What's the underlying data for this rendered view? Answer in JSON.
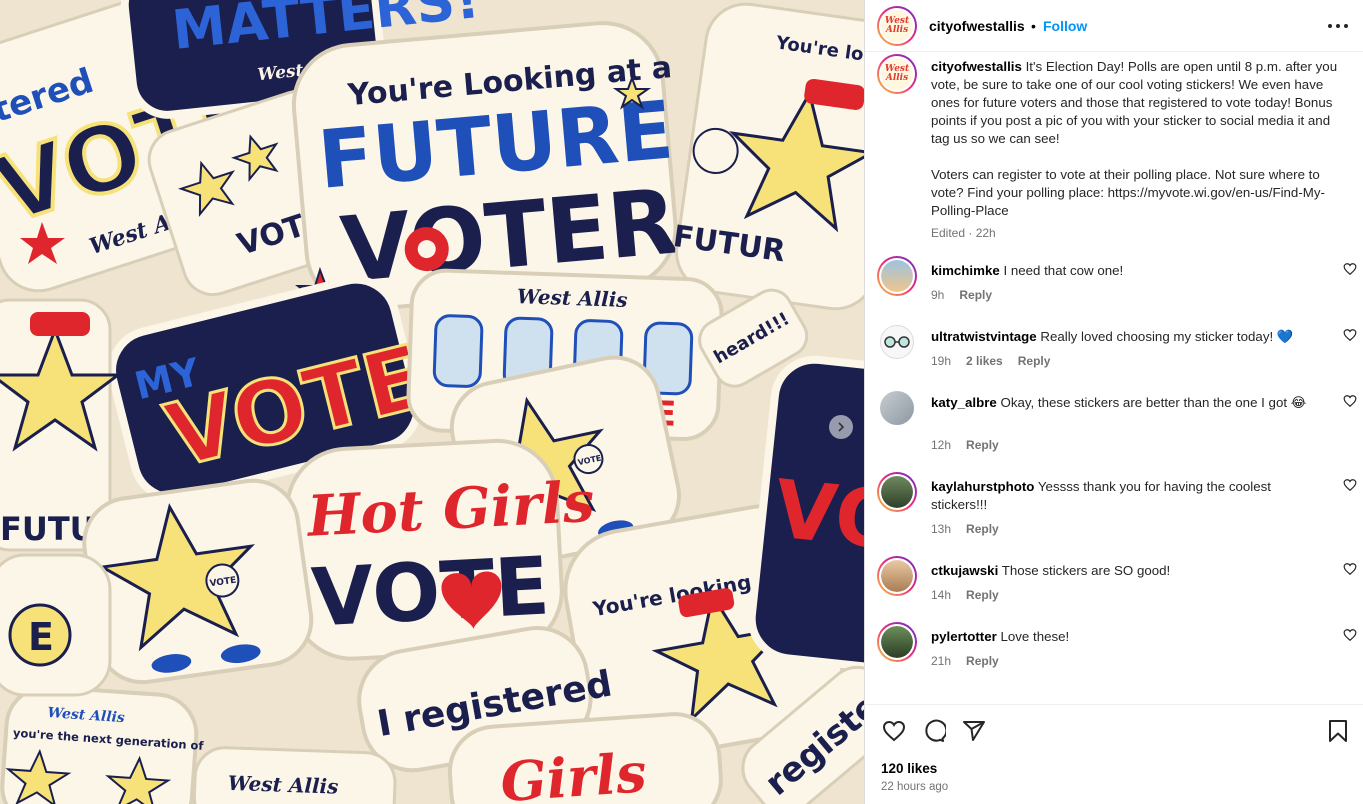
{
  "photo": {
    "alt": "Pile of West Allis voting stickers",
    "stickers": {
      "matters": "MATTERS!",
      "west_allis": "West Allis",
      "looking_at": "You're Looking at a",
      "future": "FUTURE",
      "voter": "VOTER!",
      "voters": "VOTERS!",
      "vote": "VOTE",
      "my": "MY",
      "hot_girls": "Hot Girls",
      "registered": "I registered",
      "registered2": "registe",
      "youre_looking": "You're looking at a",
      "next_gen": "you're the next generation of",
      "heard": "heard!!!",
      "istered": "stered",
      "vote_badge": "VOTE",
      "future2": "FUTUR",
      "vote_big": "VOTE",
      "love_letters": "E",
      "girls": "Girls"
    }
  },
  "header": {
    "username": "cityofwestallis",
    "avatar_text": "West Allis",
    "separator": "•",
    "follow_label": "Follow",
    "more_icon": "more-horizontal-icon"
  },
  "caption": {
    "username": "cityofwestallis",
    "text": "It's Election Day! Polls are open until 8 p.m. after you vote, be sure to take one of our cool voting stickers! We even have ones for future voters and those that registered to vote today! Bonus points if you post a pic of you with your sticker to social media it and tag us so we can see!\n\nVoters can register to vote at their polling place. Not sure where to vote? Find your polling place: https://myvote.wi.gov/en-us/Find-My-Polling-Place",
    "meta": "Edited · 22h"
  },
  "comments": [
    {
      "username": "kimchimke",
      "text": "I need that cow one!",
      "time": "9h",
      "likes": "",
      "reply": "Reply",
      "avatar_color": "#7aa7c7"
    },
    {
      "username": "ultratwistvintage",
      "text": "Really loved choosing my sticker today! 💙",
      "time": "19h",
      "likes": "2 likes",
      "reply": "Reply",
      "avatar_color": "#f2f2f2"
    },
    {
      "username": "katy_albre",
      "text": "Okay, these stickers are better than the one I got 😂",
      "time": "12h",
      "likes": "",
      "reply": "Reply",
      "avatar_color": "#9aa3ab"
    },
    {
      "username": "kaylahurstphoto",
      "text": "Yessss thank you for having the coolest stickers!!!",
      "time": "13h",
      "likes": "",
      "reply": "Reply",
      "avatar_color": "#4d6b4a"
    },
    {
      "username": "ctkujawski",
      "text": "Those stickers are SO good!",
      "time": "14h",
      "likes": "",
      "reply": "Reply",
      "avatar_color": "#c9a27a"
    },
    {
      "username": "pylertotter",
      "text": "Love these!",
      "time": "21h",
      "likes": "",
      "reply": "Reply",
      "avatar_color": "#3f5a35"
    }
  ],
  "actions": {
    "like_icon": "heart-icon",
    "comment_icon": "comment-icon",
    "share_icon": "share-icon",
    "save_icon": "bookmark-icon"
  },
  "footer": {
    "likes": "120 likes",
    "time_ago": "22 hours ago"
  },
  "colors": {
    "follow": "#0095f6",
    "sticker_red": "#e0262d",
    "sticker_blue": "#1f4fb8",
    "sticker_navy": "#1b1f4d",
    "sticker_yellow": "#f7e27a",
    "muted": "#737373"
  }
}
